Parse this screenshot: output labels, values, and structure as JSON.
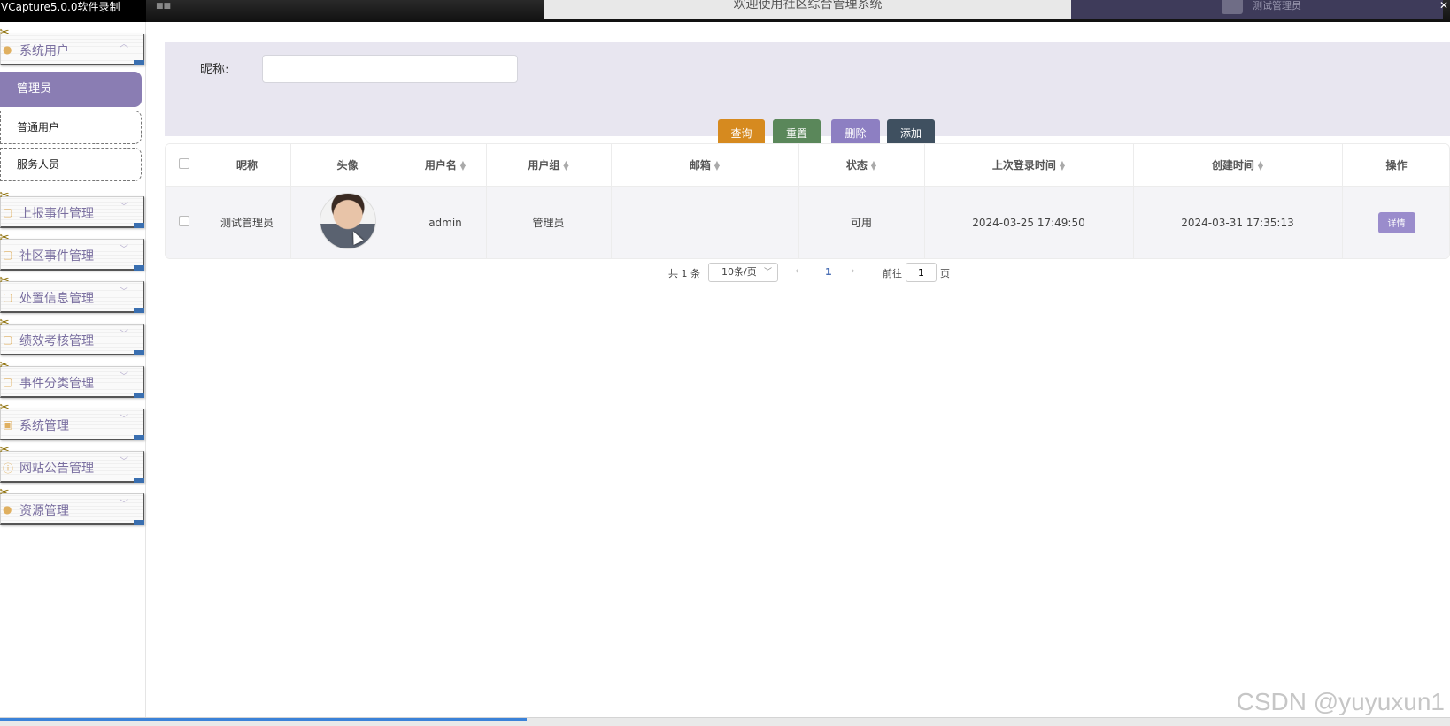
{
  "topbar": {
    "recorder_label": "VCapture5.0.0软件录制",
    "system_title": "欢迎使用社区综合管理系统",
    "user_name": "测试管理员",
    "close_glyph": "✕"
  },
  "sidebar": {
    "groups": [
      {
        "label": "系统用户",
        "icon": "user-icon"
      },
      {
        "label": "上报事件管理",
        "icon": "doc-icon"
      },
      {
        "label": "社区事件管理",
        "icon": "doc-icon"
      },
      {
        "label": "处置信息管理",
        "icon": "doc-icon"
      },
      {
        "label": "绩效考核管理",
        "icon": "doc-icon"
      },
      {
        "label": "事件分类管理",
        "icon": "doc-icon"
      },
      {
        "label": "系统管理",
        "icon": "image-icon"
      },
      {
        "label": "网站公告管理",
        "icon": "info-icon"
      },
      {
        "label": "资源管理",
        "icon": "bulb-icon"
      }
    ],
    "sub_items": [
      {
        "label": "管理员",
        "active": true
      },
      {
        "label": "普通用户",
        "active": false
      },
      {
        "label": "服务人员",
        "active": false
      }
    ]
  },
  "search": {
    "nickname_label": "昵称:",
    "nickname_value": "",
    "buttons": {
      "query": "查询",
      "reset": "重置",
      "delete": "删除",
      "add": "添加"
    }
  },
  "table": {
    "columns": [
      "昵称",
      "头像",
      "用户名",
      "用户组",
      "邮箱",
      "状态",
      "上次登录时间",
      "创建时间",
      "操作"
    ],
    "rows": [
      {
        "nickname": "测试管理员",
        "username": "admin",
        "group": "管理员",
        "email": "",
        "status": "可用",
        "last_login": "2024-03-25 17:49:50",
        "created": "2024-03-31 17:35:13",
        "action": "详情"
      }
    ]
  },
  "pagination": {
    "total": "共 1 条",
    "page_size": "10条/页",
    "current_page": "1",
    "goto_label": "前往",
    "goto_value": "1",
    "page_suffix": "页"
  },
  "watermark": "CSDN @yuyuxun1",
  "colors": {
    "accent": "#8a7db3",
    "query": "#d68a1f",
    "reset": "#5a875a",
    "delete": "#8d7fc2",
    "add": "#3f5060"
  }
}
